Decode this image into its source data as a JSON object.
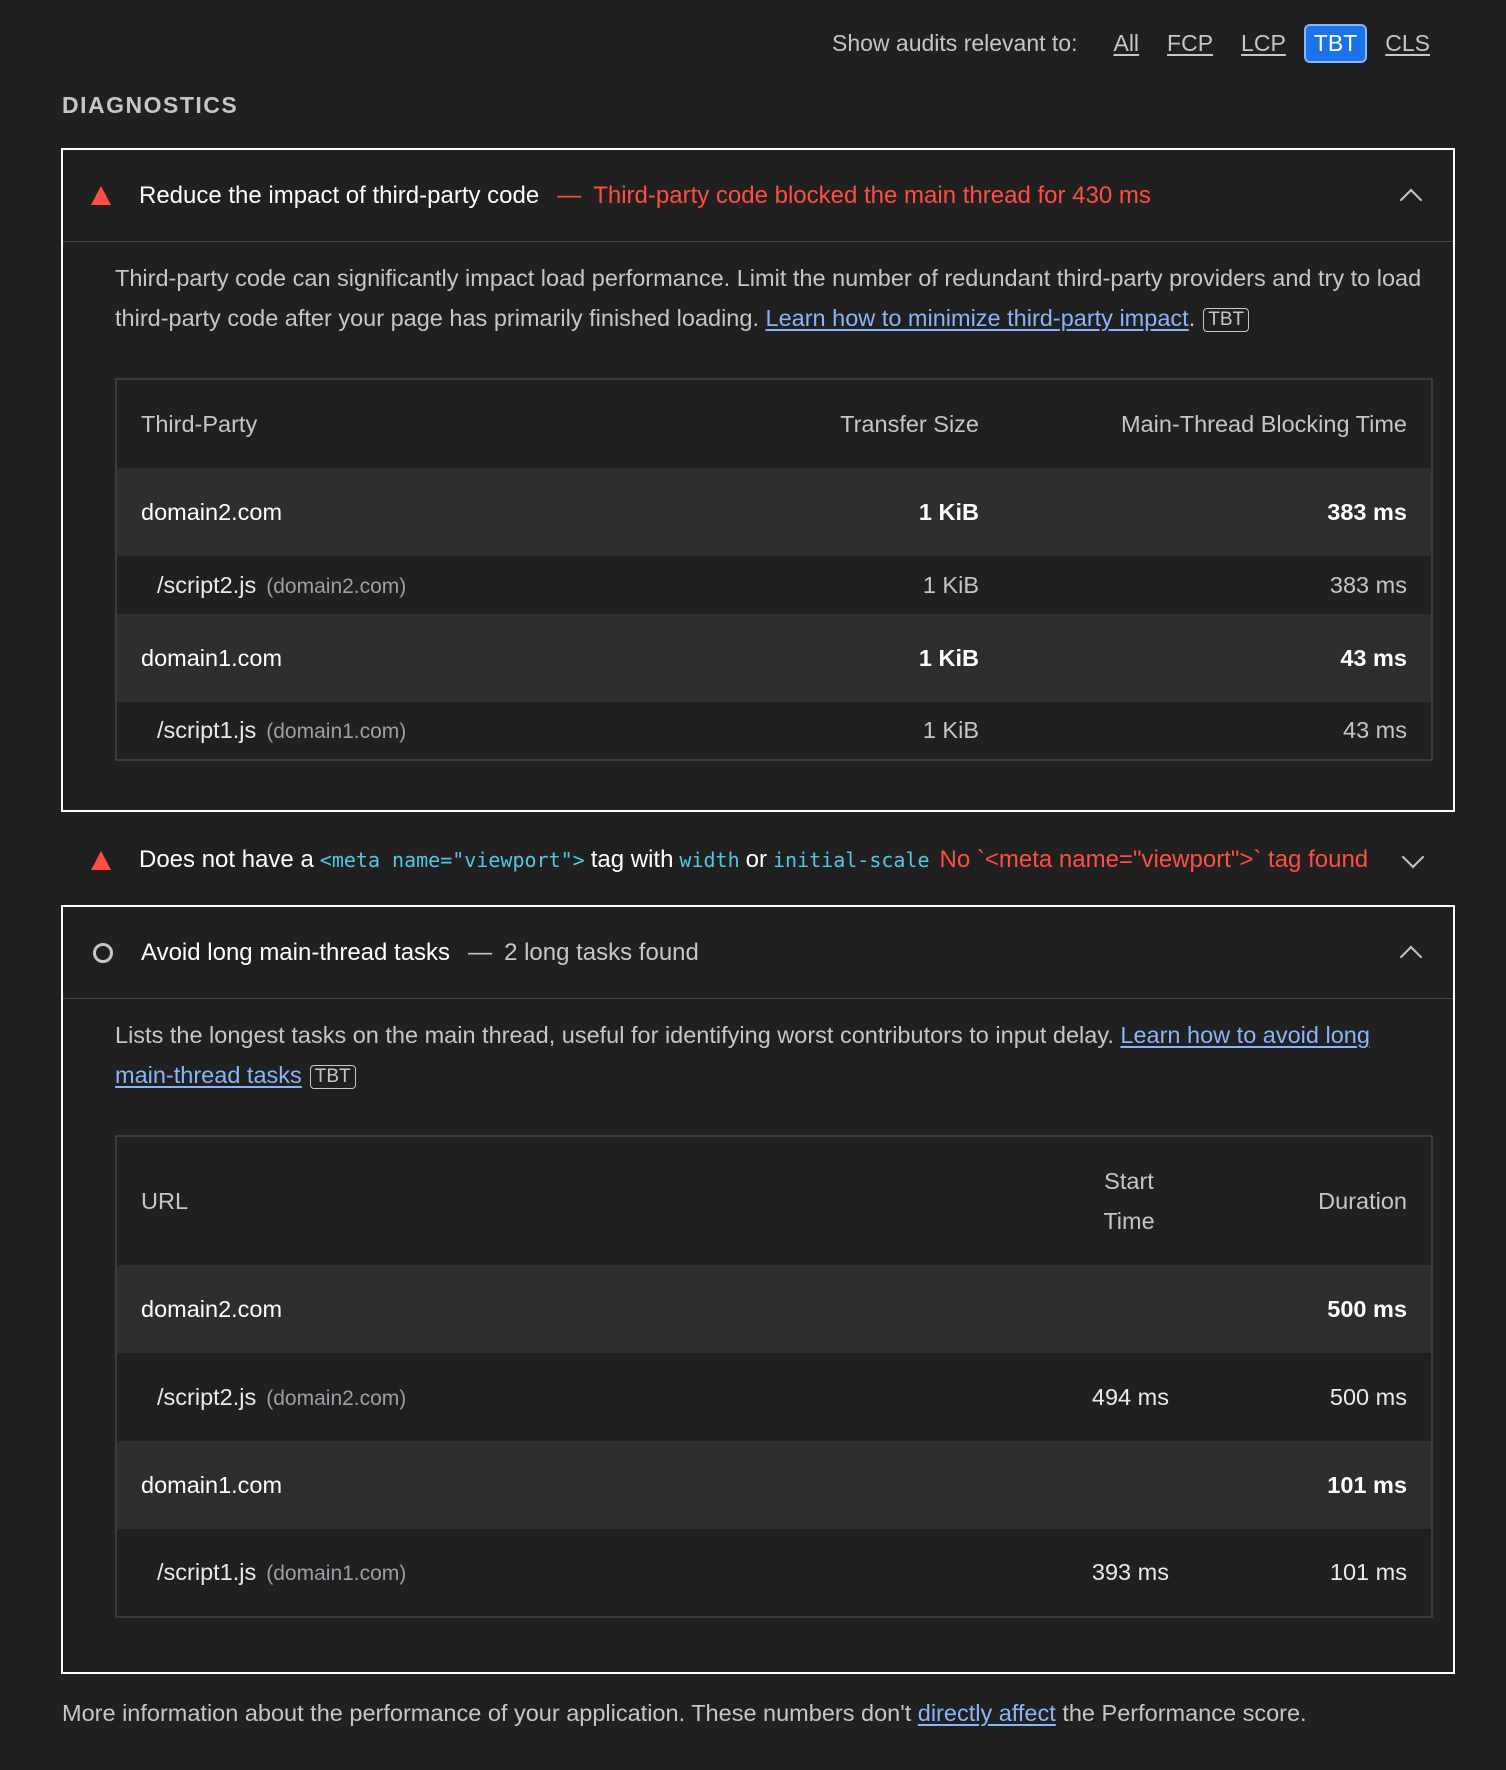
{
  "filter": {
    "label": "Show audits relevant to:",
    "chips": [
      {
        "label": "All",
        "active": false
      },
      {
        "label": "FCP",
        "active": false
      },
      {
        "label": "LCP",
        "active": false
      },
      {
        "label": "TBT",
        "active": true
      },
      {
        "label": "CLS",
        "active": false
      }
    ]
  },
  "section_title": "DIAGNOSTICS",
  "audit1": {
    "title": "Reduce the impact of third-party code",
    "separator": "—",
    "display_value": "Third-party code blocked the main thread for 430 ms",
    "desc": "Third-party code can significantly impact load performance. Limit the number of redundant third-party providers and try to load third-party code after your page has primarily finished loading. ",
    "link": "Learn how to minimize third-party impact",
    "after_link": ".",
    "tag": "TBT",
    "table": {
      "headers": [
        "Third-Party",
        "Transfer Size",
        "Main-Thread Blocking Time"
      ],
      "rows": [
        {
          "entity": "domain2.com",
          "size": "1 KiB",
          "time": "383 ms",
          "sub_url": "/script2.js",
          "sub_domain": "(domain2.com)",
          "sub_size": "1 KiB",
          "sub_time": "383 ms"
        },
        {
          "entity": "domain1.com",
          "size": "1 KiB",
          "time": "43 ms",
          "sub_url": "/script1.js",
          "sub_domain": "(domain1.com)",
          "sub_size": "1 KiB",
          "sub_time": "43 ms"
        }
      ]
    }
  },
  "audit2": {
    "title_pre": "Does not have a",
    "code1": "<meta name=\"viewport\">",
    "title_mid": "tag with",
    "code2": "width",
    "title_or": "or",
    "code3": "initial-scale",
    "display_value": "No `<meta name=\"viewport\">` tag found"
  },
  "audit3": {
    "title": "Avoid long main-thread tasks",
    "separator": "—",
    "display_value": "2 long tasks found",
    "desc": "Lists the longest tasks on the main thread, useful for identifying worst contributors to input delay. ",
    "link": "Learn how to avoid long main-thread tasks",
    "tag": "TBT",
    "table": {
      "headers": [
        "URL",
        "Start Time",
        "Duration"
      ],
      "rows": [
        {
          "entity": "domain2.com",
          "duration": "500 ms",
          "sub_url": "/script2.js",
          "sub_domain": "(domain2.com)",
          "sub_start": "494 ms",
          "sub_duration": "500 ms"
        },
        {
          "entity": "domain1.com",
          "duration": "101 ms",
          "sub_url": "/script1.js",
          "sub_domain": "(domain1.com)",
          "sub_start": "393 ms",
          "sub_duration": "101 ms"
        }
      ]
    }
  },
  "footer": {
    "pre": "More information about the performance of your application. These numbers don't ",
    "link": "directly affect",
    "post": " the Performance score."
  }
}
